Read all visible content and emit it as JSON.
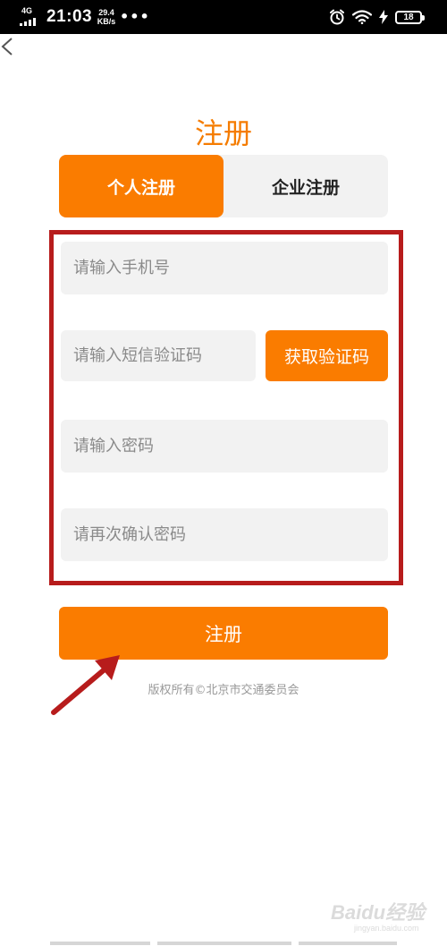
{
  "status_bar": {
    "network": "4G",
    "time": "21:03",
    "speed_value": "29.4",
    "speed_unit": "KB/s",
    "more": "•••",
    "battery": "18",
    "icons": [
      "alarm-icon",
      "wifi-icon",
      "charging-icon",
      "battery-icon"
    ]
  },
  "nav": {
    "back_icon": "chevron-left-icon"
  },
  "page": {
    "title": "注册"
  },
  "tabs": [
    {
      "label": "个人注册",
      "active": true
    },
    {
      "label": "企业注册",
      "active": false
    }
  ],
  "form": {
    "phone_placeholder": "请输入手机号",
    "sms_placeholder": "请输入短信验证码",
    "get_code_label": "获取验证码",
    "password_placeholder": "请输入密码",
    "confirm_password_placeholder": "请再次确认密码"
  },
  "submit_label": "注册",
  "copyright": "版权所有©北京市交通委员会",
  "watermark": {
    "text": "Baidu经验",
    "sub": "jingyan.baidu.com"
  },
  "colors": {
    "accent": "#fa7c00",
    "title": "#f57c00",
    "highlight_frame": "#b71c1c",
    "field_bg": "#f2f2f2"
  }
}
